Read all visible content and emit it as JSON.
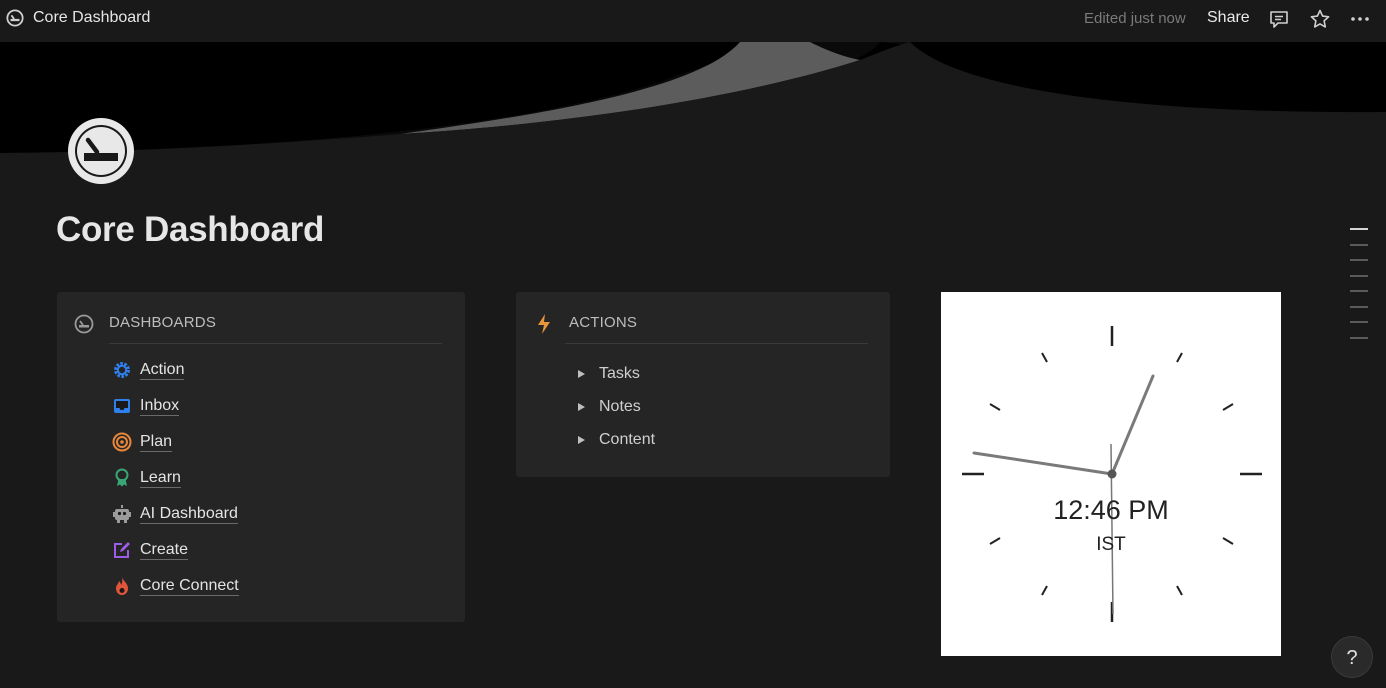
{
  "topbar": {
    "title": "Core Dashboard",
    "edited": "Edited just now",
    "share_label": "Share",
    "icons": [
      "page-icon",
      "comment-icon",
      "star-icon",
      "more-icon"
    ]
  },
  "page": {
    "title": "Core Dashboard",
    "icon": "dashboard-gauge-icon"
  },
  "dashboards": {
    "heading": "DASHBOARDS",
    "items": [
      {
        "label": "Action",
        "icon": "gear-icon",
        "color": "#2f80ed"
      },
      {
        "label": "Inbox",
        "icon": "inbox-icon",
        "color": "#2f80ed"
      },
      {
        "label": "Plan",
        "icon": "target-icon",
        "color": "#e8873a"
      },
      {
        "label": "Learn",
        "icon": "award-icon",
        "color": "#3aa676"
      },
      {
        "label": "AI Dashboard",
        "icon": "robot-icon",
        "color": "#9b9b9b"
      },
      {
        "label": "Create",
        "icon": "edit-icon",
        "color": "#9b5de5"
      },
      {
        "label": "Core Connect",
        "icon": "fire-icon",
        "color": "#e0553a"
      }
    ]
  },
  "actions": {
    "heading": "ACTIONS",
    "icon": "lightning-icon",
    "items": [
      {
        "label": "Tasks"
      },
      {
        "label": "Notes"
      },
      {
        "label": "Content"
      }
    ]
  },
  "clock": {
    "time": "12:46 PM",
    "timezone": "IST"
  },
  "help": {
    "label": "?"
  }
}
